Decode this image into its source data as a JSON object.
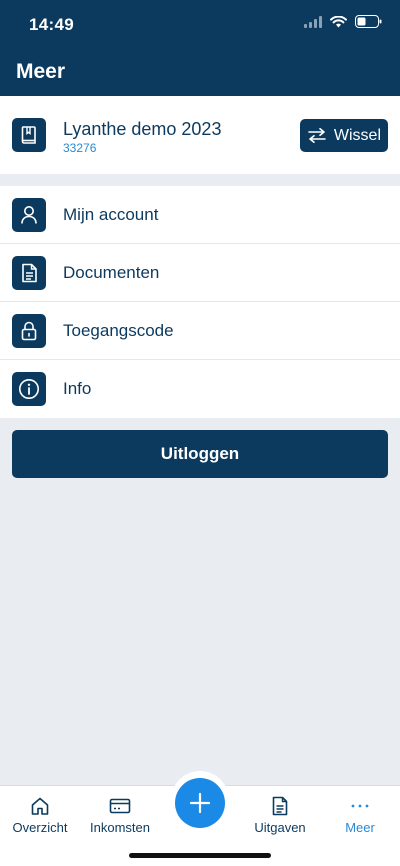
{
  "status": {
    "time": "14:49"
  },
  "header": {
    "title": "Meer"
  },
  "company": {
    "name": "Lyanthe demo 2023",
    "id": "33276",
    "switch_label": "Wissel"
  },
  "menu": {
    "items": [
      {
        "label": "Mijn account",
        "icon": "person-icon"
      },
      {
        "label": "Documenten",
        "icon": "document-icon"
      },
      {
        "label": "Toegangscode",
        "icon": "lock-icon"
      },
      {
        "label": "Info",
        "icon": "info-icon"
      }
    ]
  },
  "logout_label": "Uitloggen",
  "tabbar": {
    "tabs": [
      {
        "label": "Overzicht",
        "icon": "home-icon"
      },
      {
        "label": "Inkomsten",
        "icon": "card-icon"
      },
      {
        "label": "Uitgaven",
        "icon": "receipt-icon"
      },
      {
        "label": "Meer",
        "icon": "more-icon",
        "active": true
      }
    ],
    "fab_icon": "plus-icon"
  },
  "colors": {
    "primary": "#0c3a5e",
    "accent": "#2a8ad4",
    "fab": "#1a8ae6",
    "background": "#e9ecf1"
  }
}
